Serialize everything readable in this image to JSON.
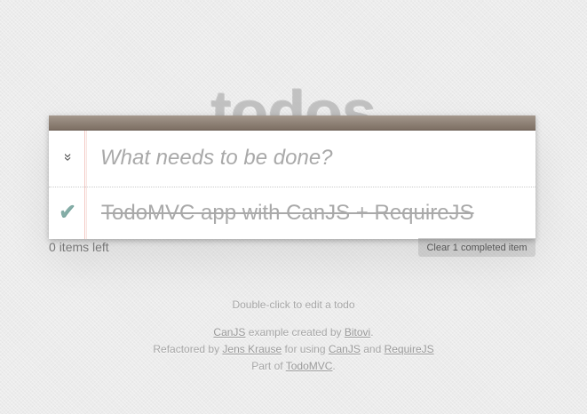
{
  "header": {
    "title": "todos"
  },
  "new_todo": {
    "placeholder": "What needs to be done?",
    "value": ""
  },
  "toggle_all": {
    "icon": "chevron-double-down-icon",
    "glyph": "»"
  },
  "todos": [
    {
      "label": "TodoMVC app with CanJS + RequireJS",
      "completed": true,
      "check_glyph": "✔"
    }
  ],
  "footer": {
    "count_number": "0",
    "count_suffix": "items left",
    "clear_label": "Clear 1 completed item"
  },
  "info": {
    "edit_hint": "Double-click to edit a todo",
    "line1": {
      "link1": "CanJS",
      "text1": "example created by",
      "link2": "Bitovi",
      "text2": "."
    },
    "line2": {
      "text1": "Refactored by",
      "link1": "Jens Krause",
      "text2": "for using",
      "link2": "CanJS",
      "text3": "and",
      "link3": "RequireJS"
    },
    "line3": {
      "text1": "Part of",
      "link1": "TodoMVC",
      "text2": "."
    }
  },
  "colors": {
    "background": "#ececec",
    "title": "#bdbdbd",
    "top_bar": "#8d7d70",
    "check": "#85ada7",
    "completed_text": "#a9a9a9"
  }
}
